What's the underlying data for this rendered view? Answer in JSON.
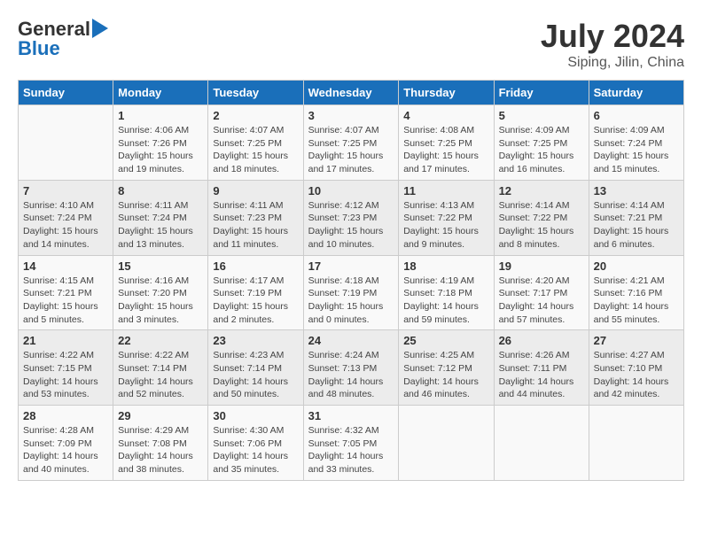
{
  "header": {
    "logo_general": "General",
    "logo_blue": "Blue",
    "title": "July 2024",
    "subtitle": "Siping, Jilin, China"
  },
  "calendar": {
    "days_of_week": [
      "Sunday",
      "Monday",
      "Tuesday",
      "Wednesday",
      "Thursday",
      "Friday",
      "Saturday"
    ],
    "weeks": [
      [
        {
          "day": "",
          "info": ""
        },
        {
          "day": "1",
          "info": "Sunrise: 4:06 AM\nSunset: 7:26 PM\nDaylight: 15 hours\nand 19 minutes."
        },
        {
          "day": "2",
          "info": "Sunrise: 4:07 AM\nSunset: 7:25 PM\nDaylight: 15 hours\nand 18 minutes."
        },
        {
          "day": "3",
          "info": "Sunrise: 4:07 AM\nSunset: 7:25 PM\nDaylight: 15 hours\nand 17 minutes."
        },
        {
          "day": "4",
          "info": "Sunrise: 4:08 AM\nSunset: 7:25 PM\nDaylight: 15 hours\nand 17 minutes."
        },
        {
          "day": "5",
          "info": "Sunrise: 4:09 AM\nSunset: 7:25 PM\nDaylight: 15 hours\nand 16 minutes."
        },
        {
          "day": "6",
          "info": "Sunrise: 4:09 AM\nSunset: 7:24 PM\nDaylight: 15 hours\nand 15 minutes."
        }
      ],
      [
        {
          "day": "7",
          "info": "Sunrise: 4:10 AM\nSunset: 7:24 PM\nDaylight: 15 hours\nand 14 minutes."
        },
        {
          "day": "8",
          "info": "Sunrise: 4:11 AM\nSunset: 7:24 PM\nDaylight: 15 hours\nand 13 minutes."
        },
        {
          "day": "9",
          "info": "Sunrise: 4:11 AM\nSunset: 7:23 PM\nDaylight: 15 hours\nand 11 minutes."
        },
        {
          "day": "10",
          "info": "Sunrise: 4:12 AM\nSunset: 7:23 PM\nDaylight: 15 hours\nand 10 minutes."
        },
        {
          "day": "11",
          "info": "Sunrise: 4:13 AM\nSunset: 7:22 PM\nDaylight: 15 hours\nand 9 minutes."
        },
        {
          "day": "12",
          "info": "Sunrise: 4:14 AM\nSunset: 7:22 PM\nDaylight: 15 hours\nand 8 minutes."
        },
        {
          "day": "13",
          "info": "Sunrise: 4:14 AM\nSunset: 7:21 PM\nDaylight: 15 hours\nand 6 minutes."
        }
      ],
      [
        {
          "day": "14",
          "info": "Sunrise: 4:15 AM\nSunset: 7:21 PM\nDaylight: 15 hours\nand 5 minutes."
        },
        {
          "day": "15",
          "info": "Sunrise: 4:16 AM\nSunset: 7:20 PM\nDaylight: 15 hours\nand 3 minutes."
        },
        {
          "day": "16",
          "info": "Sunrise: 4:17 AM\nSunset: 7:19 PM\nDaylight: 15 hours\nand 2 minutes."
        },
        {
          "day": "17",
          "info": "Sunrise: 4:18 AM\nSunset: 7:19 PM\nDaylight: 15 hours\nand 0 minutes."
        },
        {
          "day": "18",
          "info": "Sunrise: 4:19 AM\nSunset: 7:18 PM\nDaylight: 14 hours\nand 59 minutes."
        },
        {
          "day": "19",
          "info": "Sunrise: 4:20 AM\nSunset: 7:17 PM\nDaylight: 14 hours\nand 57 minutes."
        },
        {
          "day": "20",
          "info": "Sunrise: 4:21 AM\nSunset: 7:16 PM\nDaylight: 14 hours\nand 55 minutes."
        }
      ],
      [
        {
          "day": "21",
          "info": "Sunrise: 4:22 AM\nSunset: 7:15 PM\nDaylight: 14 hours\nand 53 minutes."
        },
        {
          "day": "22",
          "info": "Sunrise: 4:22 AM\nSunset: 7:14 PM\nDaylight: 14 hours\nand 52 minutes."
        },
        {
          "day": "23",
          "info": "Sunrise: 4:23 AM\nSunset: 7:14 PM\nDaylight: 14 hours\nand 50 minutes."
        },
        {
          "day": "24",
          "info": "Sunrise: 4:24 AM\nSunset: 7:13 PM\nDaylight: 14 hours\nand 48 minutes."
        },
        {
          "day": "25",
          "info": "Sunrise: 4:25 AM\nSunset: 7:12 PM\nDaylight: 14 hours\nand 46 minutes."
        },
        {
          "day": "26",
          "info": "Sunrise: 4:26 AM\nSunset: 7:11 PM\nDaylight: 14 hours\nand 44 minutes."
        },
        {
          "day": "27",
          "info": "Sunrise: 4:27 AM\nSunset: 7:10 PM\nDaylight: 14 hours\nand 42 minutes."
        }
      ],
      [
        {
          "day": "28",
          "info": "Sunrise: 4:28 AM\nSunset: 7:09 PM\nDaylight: 14 hours\nand 40 minutes."
        },
        {
          "day": "29",
          "info": "Sunrise: 4:29 AM\nSunset: 7:08 PM\nDaylight: 14 hours\nand 38 minutes."
        },
        {
          "day": "30",
          "info": "Sunrise: 4:30 AM\nSunset: 7:06 PM\nDaylight: 14 hours\nand 35 minutes."
        },
        {
          "day": "31",
          "info": "Sunrise: 4:32 AM\nSunset: 7:05 PM\nDaylight: 14 hours\nand 33 minutes."
        },
        {
          "day": "",
          "info": ""
        },
        {
          "day": "",
          "info": ""
        },
        {
          "day": "",
          "info": ""
        }
      ]
    ]
  }
}
